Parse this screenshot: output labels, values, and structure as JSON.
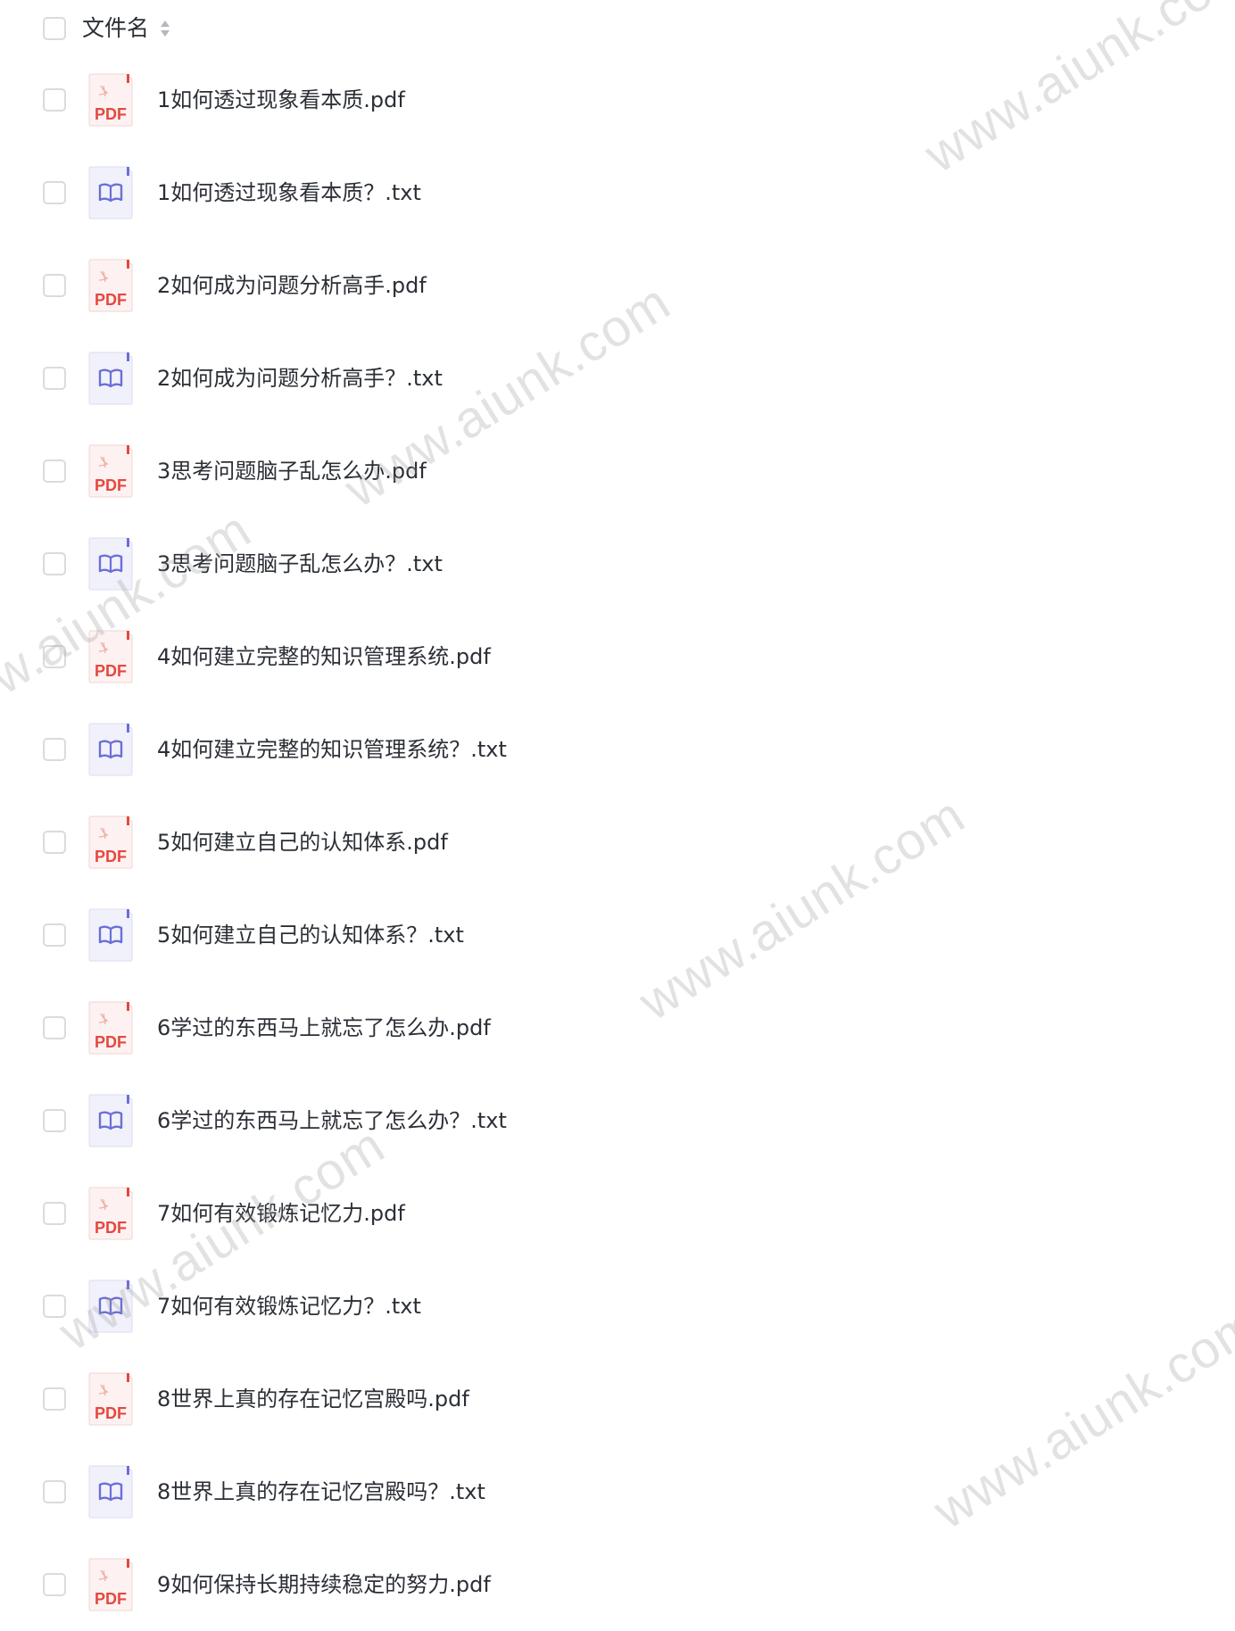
{
  "header": {
    "column_label": "文件名",
    "sort_icon": "sort-icon"
  },
  "files": [
    {
      "name": "1如何透过现象看本质.pdf",
      "type": "pdf"
    },
    {
      "name": "1如何透过现象看本质？.txt",
      "type": "txt"
    },
    {
      "name": "2如何成为问题分析高手.pdf",
      "type": "pdf"
    },
    {
      "name": "2如何成为问题分析高手？.txt",
      "type": "txt"
    },
    {
      "name": "3思考问题脑子乱怎么办.pdf",
      "type": "pdf"
    },
    {
      "name": "3思考问题脑子乱怎么办？.txt",
      "type": "txt"
    },
    {
      "name": "4如何建立完整的知识管理系统.pdf",
      "type": "pdf"
    },
    {
      "name": "4如何建立完整的知识管理系统？.txt",
      "type": "txt"
    },
    {
      "name": "5如何建立自己的认知体系.pdf",
      "type": "pdf"
    },
    {
      "name": "5如何建立自己的认知体系？.txt",
      "type": "txt"
    },
    {
      "name": "6学过的东西马上就忘了怎么办.pdf",
      "type": "pdf"
    },
    {
      "name": "6学过的东西马上就忘了怎么办？.txt",
      "type": "txt"
    },
    {
      "name": "7如何有效锻炼记忆力.pdf",
      "type": "pdf"
    },
    {
      "name": "7如何有效锻炼记忆力？.txt",
      "type": "txt"
    },
    {
      "name": "8世界上真的存在记忆宫殿吗.pdf",
      "type": "pdf"
    },
    {
      "name": "8世界上真的存在记忆宫殿吗？.txt",
      "type": "txt"
    },
    {
      "name": "9如何保持长期持续稳定的努力.pdf",
      "type": "pdf"
    }
  ],
  "icons": {
    "pdf": {
      "name": "pdf-file-icon",
      "label": "PDF",
      "color": "#e5483f",
      "background": "#fdf2f1"
    },
    "txt": {
      "name": "book-file-icon",
      "color": "#6b6fd6",
      "background": "#f1f1fb"
    }
  },
  "watermark": {
    "text": "www.aiunk.com",
    "color": "#9a9a9a"
  }
}
